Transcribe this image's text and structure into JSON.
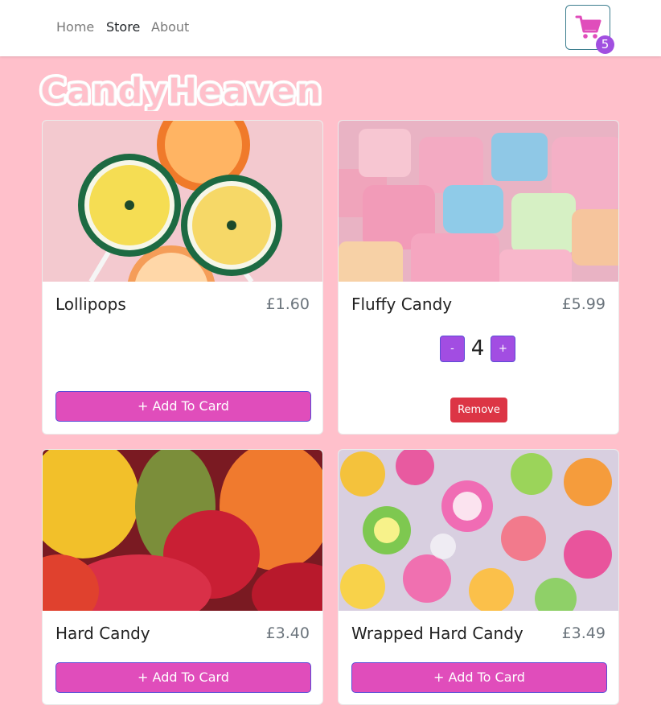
{
  "nav": {
    "links": [
      {
        "label": "Home",
        "active": false
      },
      {
        "label": "Store",
        "active": true
      },
      {
        "label": "About",
        "active": false
      }
    ],
    "cart": {
      "icon": "shopping-cart-icon",
      "count": "5"
    }
  },
  "brand": {
    "logo_text": "CandyHeaven"
  },
  "colors": {
    "page_bg": "#ffc0cb",
    "accent_pink": "#e04dbb",
    "accent_purple": "#a24de2",
    "danger": "#dc3545"
  },
  "products": [
    {
      "name": "Lollipops",
      "price": "£1.60",
      "in_cart": false,
      "add_label": "+ Add To Card"
    },
    {
      "name": "Fluffy Candy",
      "price": "£5.99",
      "in_cart": true,
      "quantity": "4",
      "minus_label": "-",
      "plus_label": "+",
      "remove_label": "Remove"
    },
    {
      "name": "Hard Candy",
      "price": "£3.40",
      "in_cart": false,
      "add_label": "+ Add To Card"
    },
    {
      "name": "Wrapped Hard Candy",
      "price": "£3.49",
      "in_cart": false,
      "add_label": "+ Add To Card"
    }
  ]
}
